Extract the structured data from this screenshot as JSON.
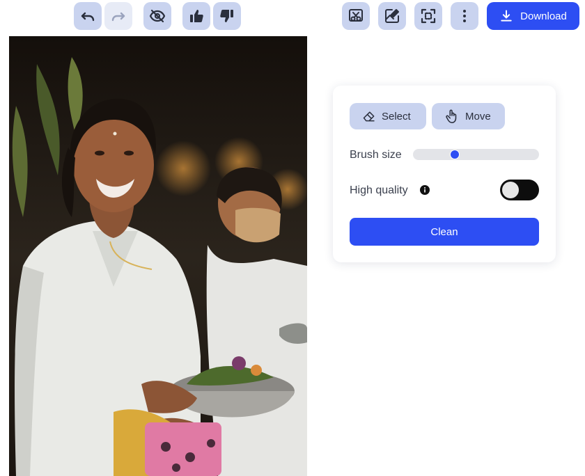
{
  "toolbar": {
    "left_buttons": [
      {
        "name": "undo-button",
        "icon": "undo-icon",
        "enabled": true
      },
      {
        "name": "redo-button",
        "icon": "redo-icon",
        "enabled": false
      },
      {
        "name": "hide-original-button",
        "icon": "eye-off-icon",
        "enabled": true
      },
      {
        "name": "thumbs-up-button",
        "icon": "thumbs-up-icon",
        "enabled": true
      },
      {
        "name": "thumbs-down-button",
        "icon": "thumbs-down-icon",
        "enabled": true
      }
    ],
    "right_buttons": [
      {
        "name": "cutout-button",
        "icon": "scissors-icon"
      },
      {
        "name": "edit-image-button",
        "icon": "image-edit-icon"
      },
      {
        "name": "crop-focus-button",
        "icon": "focus-frame-icon"
      },
      {
        "name": "more-options-button",
        "icon": "more-vertical-icon"
      }
    ],
    "download_label": "Download"
  },
  "canvas": {
    "image_alt": "Photo of a smiling woman in a white blouse holding a metal bowl of offerings, with another woman wearing a face mask behind her"
  },
  "panel": {
    "select_label": "Select",
    "move_label": "Move",
    "brush_label": "Brush size",
    "brush_value": 0.32,
    "quality_label": "High quality",
    "quality_enabled": false,
    "clean_label": "Clean"
  },
  "colors": {
    "accent": "#2d4ef3",
    "button_bg": "#c9d3ef",
    "button_disabled_bg": "#e7ebf6",
    "icon": "#2a2f3d",
    "toggle_bg": "#0d0d0d"
  }
}
